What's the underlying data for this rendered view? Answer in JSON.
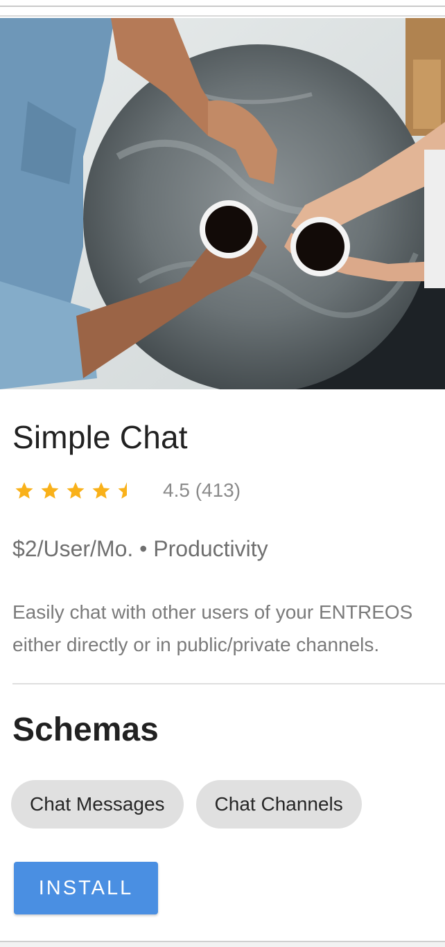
{
  "app": {
    "name": "Simple Chat",
    "rating": {
      "value": 4.5,
      "max": 5,
      "text": "4.5 (413)"
    },
    "meta": "$2/User/Mo. • Productivity",
    "description": "Easily chat with other users of your ENTREOS either directly or in public/private channels."
  },
  "schemas": {
    "title": "Schemas",
    "chips": [
      "Chat Messages",
      "Chat Channels"
    ]
  },
  "actions": {
    "install_label": "INSTALL"
  },
  "colors": {
    "star": "#f9b11a",
    "install_button": "#4a8fe2",
    "chip_bg": "#e0e0e0"
  },
  "icons": {
    "star": "star-icon",
    "half_star": "half-star-icon"
  }
}
